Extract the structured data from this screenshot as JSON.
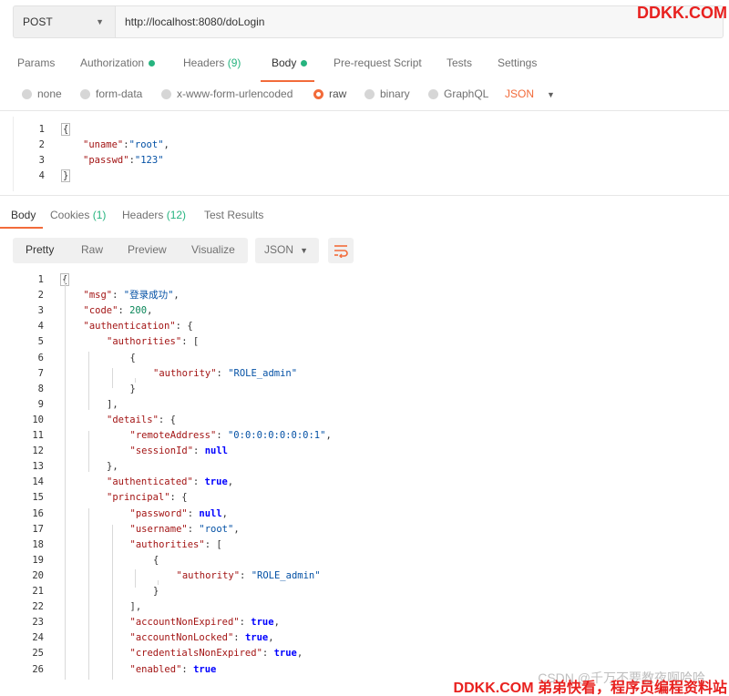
{
  "watermark_top": "DDKK.COM",
  "watermark_bottom": "DDKK.COM 弟弟快看，程序员编程资料站",
  "watermark_csdn": "CSDN @千万不要教夜啊哈哈",
  "request": {
    "method": "POST",
    "url": "http://localhost:8080/doLogin",
    "tabs": [
      {
        "label": "Params"
      },
      {
        "label": "Authorization"
      },
      {
        "label": "Headers",
        "count": "(9)"
      },
      {
        "label": "Body"
      },
      {
        "label": "Pre-request Script"
      },
      {
        "label": "Tests"
      },
      {
        "label": "Settings"
      }
    ],
    "body_types": [
      "none",
      "form-data",
      "x-www-form-urlencoded",
      "raw",
      "binary",
      "GraphQL"
    ],
    "body_format": "JSON",
    "body_lines": [
      {
        "n": "1",
        "t": "{"
      },
      {
        "n": "2",
        "k": "\"uname\"",
        "v": "\"root\"",
        "c": ","
      },
      {
        "n": "3",
        "k": "\"passwd\"",
        "v": "\"123\""
      },
      {
        "n": "4",
        "t": "}"
      }
    ]
  },
  "response": {
    "tabs": [
      {
        "label": "Body"
      },
      {
        "label": "Cookies",
        "count": "(1)"
      },
      {
        "label": "Headers",
        "count": "(12)"
      },
      {
        "label": "Test Results"
      }
    ],
    "views": [
      "Pretty",
      "Raw",
      "Preview",
      "Visualize"
    ],
    "format": "JSON",
    "lines": [
      {
        "n": "1",
        "t": "{"
      },
      {
        "n": "2",
        "k": "\"msg\"",
        "v": "\"登录成功\"",
        "vt": "str",
        "c": ","
      },
      {
        "n": "3",
        "k": "\"code\"",
        "v": "200",
        "vt": "num",
        "c": ","
      },
      {
        "n": "4",
        "k": "\"authentication\"",
        "t2": "{"
      },
      {
        "n": "5",
        "k": "\"authorities\"",
        "t2": "["
      },
      {
        "n": "6",
        "t": "{"
      },
      {
        "n": "7",
        "k": "\"authority\"",
        "v": "\"ROLE_admin\"",
        "vt": "str"
      },
      {
        "n": "8",
        "t": "}"
      },
      {
        "n": "9",
        "t": "],"
      },
      {
        "n": "10",
        "k": "\"details\"",
        "t2": "{"
      },
      {
        "n": "11",
        "k": "\"remoteAddress\"",
        "v": "\"0:0:0:0:0:0:0:1\"",
        "vt": "str",
        "c": ","
      },
      {
        "n": "12",
        "k": "\"sessionId\"",
        "v": "null",
        "vt": "kw"
      },
      {
        "n": "13",
        "t": "},"
      },
      {
        "n": "14",
        "k": "\"authenticated\"",
        "v": "true",
        "vt": "kw",
        "c": ","
      },
      {
        "n": "15",
        "k": "\"principal\"",
        "t2": "{"
      },
      {
        "n": "16",
        "k": "\"password\"",
        "v": "null",
        "vt": "kw",
        "c": ","
      },
      {
        "n": "17",
        "k": "\"username\"",
        "v": "\"root\"",
        "vt": "str",
        "c": ","
      },
      {
        "n": "18",
        "k": "\"authorities\"",
        "t2": "["
      },
      {
        "n": "19",
        "t": "{"
      },
      {
        "n": "20",
        "k": "\"authority\"",
        "v": "\"ROLE_admin\"",
        "vt": "str"
      },
      {
        "n": "21",
        "t": "}"
      },
      {
        "n": "22",
        "t": "],"
      },
      {
        "n": "23",
        "k": "\"accountNonExpired\"",
        "v": "true",
        "vt": "kw",
        "c": ","
      },
      {
        "n": "24",
        "k": "\"accountNonLocked\"",
        "v": "true",
        "vt": "kw",
        "c": ","
      },
      {
        "n": "25",
        "k": "\"credentialsNonExpired\"",
        "v": "true",
        "vt": "kw",
        "c": ","
      },
      {
        "n": "26",
        "k": "\"enabled\"",
        "v": "true",
        "vt": "kw"
      }
    ]
  },
  "colors": {
    "accent": "#f26b3a",
    "success": "#26b47f"
  }
}
